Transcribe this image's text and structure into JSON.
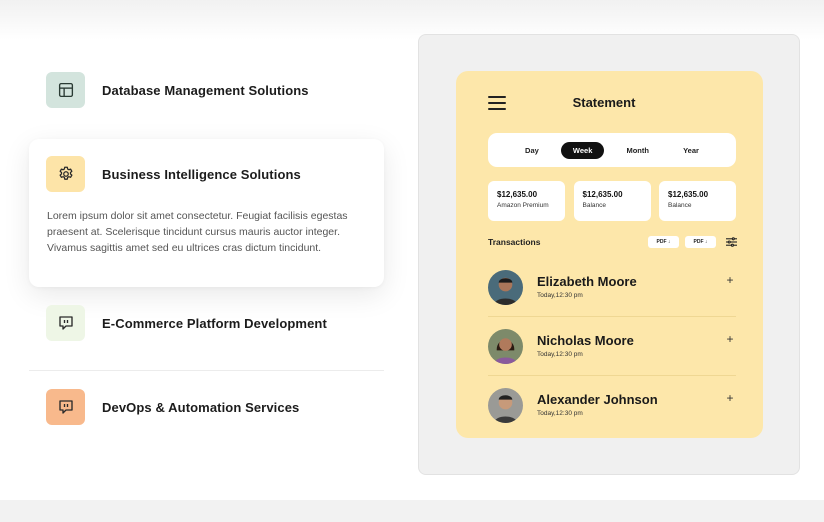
{
  "services": [
    {
      "title": "Database Management Solutions",
      "icon": "layout-icon"
    },
    {
      "title": "Business Intelligence Solutions",
      "icon": "gear-icon",
      "description": "Lorem ipsum dolor sit amet consectetur. Feugiat facilisis egestas praesent at. Scelerisque tincidunt cursus mauris auctor integer. Vivamus sagittis amet sed eu ultrices cras dictum tincidunt."
    },
    {
      "title": "E-Commerce Platform Development",
      "icon": "chat-icon"
    },
    {
      "title": "DevOps & Automation Services",
      "icon": "chat-icon"
    }
  ],
  "colors": {
    "db_icon_bg": "#d3e4dd",
    "bi_icon_bg": "#fde4a8",
    "ec_icon_bg": "#eef6e6",
    "do_icon_bg": "#f8b98c",
    "phone_bg": "#fde7aa"
  },
  "statement": {
    "title": "Statement",
    "periods": [
      "Day",
      "Week",
      "Month",
      "Year"
    ],
    "active_period": "Week",
    "balances": [
      {
        "amount": "$12,635.00",
        "label": "Amazon Premium"
      },
      {
        "amount": "$12,635.00",
        "label": "Balance"
      },
      {
        "amount": "$12,635.00",
        "label": "Balance"
      }
    ],
    "transactions_title": "Transactions",
    "pdf_label": "PDF",
    "transactions": [
      {
        "name": "Elizabeth Moore",
        "time": "Today,12:30 pm",
        "action": "+"
      },
      {
        "name": "Nicholas Moore",
        "time": "Today,12:30 pm",
        "action": "+"
      },
      {
        "name": "Alexander Johnson",
        "time": "Today,12:30 pm",
        "action": "+"
      }
    ]
  }
}
